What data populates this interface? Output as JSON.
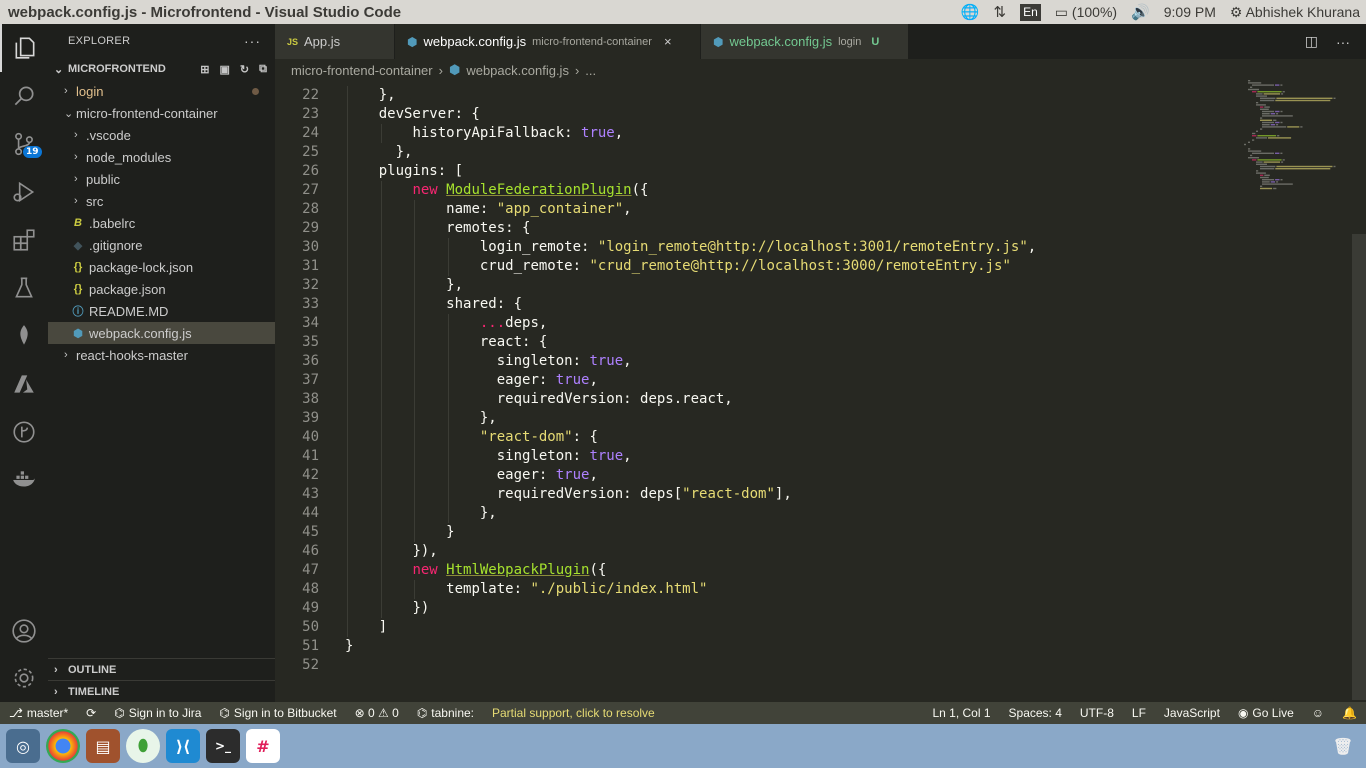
{
  "window_title": "webpack.config.js - Microfrontend - Visual Studio Code",
  "system_tray": {
    "lang": "En",
    "battery": "(100%)",
    "clock": "9:09 PM",
    "user": "Abhishek Khurana"
  },
  "activity": {
    "scm_badge": "19"
  },
  "explorer": {
    "title": "EXPLORER",
    "more": "···",
    "section": "MICROFRONTEND",
    "items": [
      {
        "label": "login",
        "icon": "",
        "chev": "›",
        "color": "#e2c08d"
      },
      {
        "label": "micro-frontend-container",
        "icon": "",
        "chev": "⌄",
        "color": "#cccccc"
      },
      {
        "label": ".vscode",
        "icon": "",
        "chev": "›",
        "color": "#cccccc"
      },
      {
        "label": "node_modules",
        "icon": "",
        "chev": "›",
        "color": "#cccccc"
      },
      {
        "label": "public",
        "icon": "",
        "chev": "›",
        "color": "#cccccc"
      },
      {
        "label": "src",
        "icon": "",
        "chev": "›",
        "color": "#cccccc"
      },
      {
        "label": ".babelrc",
        "icon": "B",
        "chev": "",
        "color": "#cccccc"
      },
      {
        "label": ".gitignore",
        "icon": "◆",
        "chev": "",
        "color": "#cccccc"
      },
      {
        "label": "package-lock.json",
        "icon": "{}",
        "chev": "",
        "color": "#cccccc"
      },
      {
        "label": "package.json",
        "icon": "{}",
        "chev": "",
        "color": "#cccccc"
      },
      {
        "label": "README.MD",
        "icon": "ⓘ",
        "chev": "",
        "color": "#cccccc"
      },
      {
        "label": "webpack.config.js",
        "icon": "⬢",
        "chev": "",
        "color": "#cccccc"
      },
      {
        "label": "react-hooks-master",
        "icon": "",
        "chev": "›",
        "color": "#cccccc"
      }
    ],
    "outline": "OUTLINE",
    "timeline": "TIMELINE"
  },
  "tabs": [
    {
      "icon": "JS",
      "label": "App.js",
      "desc": "",
      "close": "",
      "u": ""
    },
    {
      "icon": "⬢",
      "label": "webpack.config.js",
      "desc": "micro-frontend-container",
      "close": "×",
      "u": ""
    },
    {
      "icon": "⬢",
      "label": "webpack.config.js",
      "desc": "login",
      "close": "",
      "u": "U"
    }
  ],
  "breadcrumb": {
    "folder": "micro-frontend-container",
    "file": "webpack.config.js",
    "tail": "..."
  },
  "code_lines": [
    {
      "n": "22",
      "i": 2,
      "t": [
        [
          "p",
          "},"
        ]
      ]
    },
    {
      "n": "23",
      "i": 2,
      "t": [
        [
          "p",
          "devServer: {"
        ]
      ]
    },
    {
      "n": "24",
      "i": 4,
      "t": [
        [
          "p",
          "historyApiFallback: "
        ],
        [
          "b",
          "true"
        ],
        [
          "p",
          ","
        ]
      ]
    },
    {
      "n": "25",
      "i": 3,
      "t": [
        [
          "p",
          "},"
        ]
      ]
    },
    {
      "n": "26",
      "i": 2,
      "t": [
        [
          "p",
          "plugins: ["
        ]
      ]
    },
    {
      "n": "27",
      "i": 4,
      "t": [
        [
          "k",
          "new "
        ],
        [
          "c",
          "ModuleFederationPlugin"
        ],
        [
          "p",
          "({"
        ]
      ]
    },
    {
      "n": "28",
      "i": 6,
      "t": [
        [
          "p",
          "name: "
        ],
        [
          "s",
          "\"app_container\""
        ],
        [
          "p",
          ","
        ]
      ]
    },
    {
      "n": "29",
      "i": 6,
      "t": [
        [
          "p",
          "remotes: {"
        ]
      ]
    },
    {
      "n": "30",
      "i": 8,
      "t": [
        [
          "p",
          "login_remote: "
        ],
        [
          "s",
          "\"login_remote@http://localhost:3001/remoteEntry.js\""
        ],
        [
          "p",
          ","
        ]
      ]
    },
    {
      "n": "31",
      "i": 8,
      "t": [
        [
          "p",
          "crud_remote: "
        ],
        [
          "s",
          "\"crud_remote@http://localhost:3000/remoteEntry.js\""
        ]
      ]
    },
    {
      "n": "32",
      "i": 6,
      "t": [
        [
          "p",
          "},"
        ]
      ]
    },
    {
      "n": "33",
      "i": 6,
      "t": [
        [
          "p",
          "shared: {"
        ]
      ]
    },
    {
      "n": "34",
      "i": 8,
      "t": [
        [
          "o",
          "..."
        ],
        [
          "p",
          "deps,"
        ]
      ]
    },
    {
      "n": "35",
      "i": 8,
      "t": [
        [
          "p",
          "react: {"
        ]
      ]
    },
    {
      "n": "36",
      "i": 9,
      "t": [
        [
          "p",
          "singleton: "
        ],
        [
          "b",
          "true"
        ],
        [
          "p",
          ","
        ]
      ]
    },
    {
      "n": "37",
      "i": 9,
      "t": [
        [
          "p",
          "eager: "
        ],
        [
          "b",
          "true"
        ],
        [
          "p",
          ","
        ]
      ]
    },
    {
      "n": "38",
      "i": 9,
      "t": [
        [
          "p",
          "requiredVersion: deps.react,"
        ]
      ]
    },
    {
      "n": "39",
      "i": 8,
      "t": [
        [
          "p",
          "},"
        ]
      ]
    },
    {
      "n": "40",
      "i": 8,
      "t": [
        [
          "s",
          "\"react-dom\""
        ],
        [
          "p",
          ": {"
        ]
      ]
    },
    {
      "n": "41",
      "i": 9,
      "t": [
        [
          "p",
          "singleton: "
        ],
        [
          "b",
          "true"
        ],
        [
          "p",
          ","
        ]
      ]
    },
    {
      "n": "42",
      "i": 9,
      "t": [
        [
          "p",
          "eager: "
        ],
        [
          "b",
          "true"
        ],
        [
          "p",
          ","
        ]
      ]
    },
    {
      "n": "43",
      "i": 9,
      "t": [
        [
          "p",
          "requiredVersion: deps["
        ],
        [
          "s",
          "\"react-dom\""
        ],
        [
          "p",
          "],"
        ]
      ]
    },
    {
      "n": "44",
      "i": 8,
      "t": [
        [
          "p",
          "},"
        ]
      ]
    },
    {
      "n": "45",
      "i": 6,
      "t": [
        [
          "p",
          "}"
        ]
      ]
    },
    {
      "n": "46",
      "i": 4,
      "t": [
        [
          "p",
          "}),"
        ]
      ]
    },
    {
      "n": "47",
      "i": 4,
      "t": [
        [
          "k",
          "new "
        ],
        [
          "c",
          "HtmlWebpackPlugin"
        ],
        [
          "p",
          "({"
        ]
      ]
    },
    {
      "n": "48",
      "i": 6,
      "t": [
        [
          "p",
          "template: "
        ],
        [
          "s",
          "\"./public/index.html\""
        ]
      ]
    },
    {
      "n": "49",
      "i": 4,
      "t": [
        [
          "p",
          "})"
        ]
      ]
    },
    {
      "n": "50",
      "i": 2,
      "t": [
        [
          "p",
          "]"
        ]
      ]
    },
    {
      "n": "51",
      "i": 0,
      "t": [
        [
          "p",
          "}"
        ]
      ]
    },
    {
      "n": "52",
      "i": 0,
      "t": []
    }
  ],
  "status": {
    "branch": "master*",
    "jira": "Sign in to Jira",
    "bitbucket": "Sign in to Bitbucket",
    "problems": "⊗ 0 ⚠ 0",
    "tabnine": "tabnine:",
    "tabnine_msg": "Partial support, click to resolve",
    "position": "Ln 1, Col 1",
    "spaces": "Spaces: 4",
    "encoding": "UTF-8",
    "eol": "LF",
    "language": "JavaScript",
    "golive": "Go Live"
  },
  "dock_apps": [
    "ubuntu-icon",
    "chrome-icon",
    "files-icon",
    "mongodb-icon",
    "vscode-icon",
    "terminal-icon",
    "slack-icon"
  ],
  "colors": {
    "editor_bg": "#272822",
    "sidebar_bg": "#1e1f1c",
    "keyword": "#f92672",
    "string": "#e6db74",
    "class": "#a6e22e",
    "boolean": "#ae81ff",
    "status_bg": "#414339"
  }
}
